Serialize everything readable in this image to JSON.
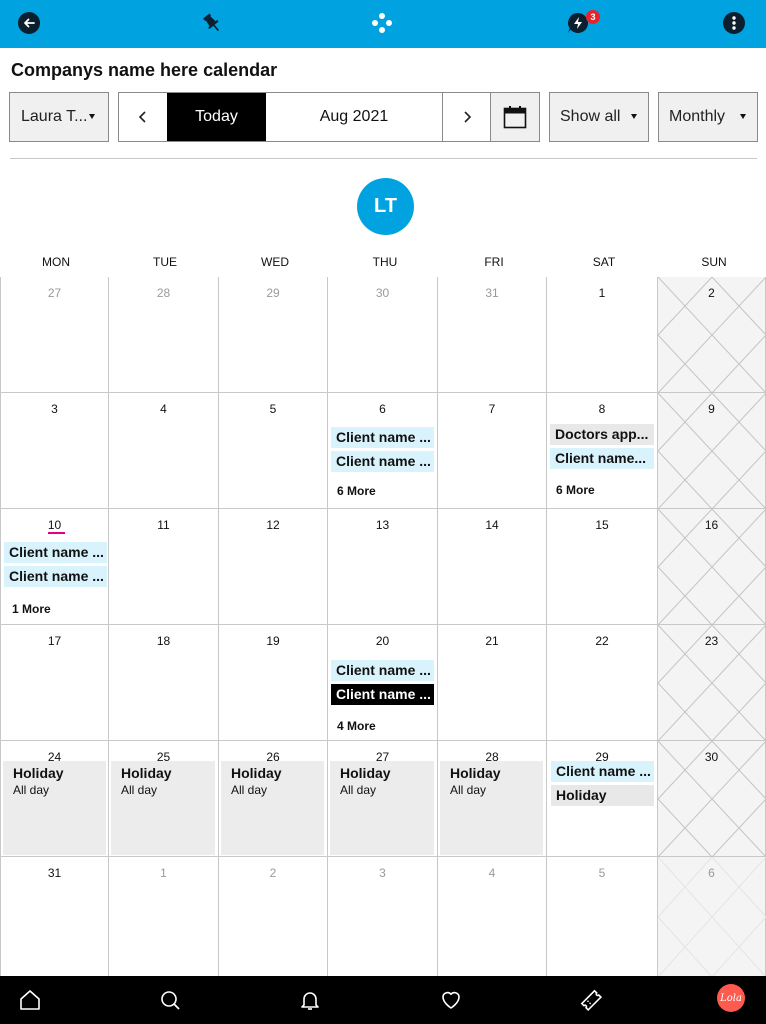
{
  "topbar": {
    "icons": [
      "back-icon",
      "pin-icon",
      "apps-icon",
      "notifications-bolt-icon",
      "more-vertical-icon"
    ],
    "badge_count": "3",
    "accent": "#00a3e0"
  },
  "page_title": "Companys name here calendar",
  "toolbar": {
    "user_select": "Laura T...",
    "today_label": "Today",
    "period_label": "Aug 2021",
    "filter_select": "Show all",
    "view_select": "Monthly"
  },
  "avatar_initials": "LT",
  "weekdays": [
    "MON",
    "TUE",
    "WED",
    "THU",
    "FRI",
    "SAT",
    "SUN"
  ],
  "weeks": [
    [
      "27",
      "28",
      "29",
      "30",
      "31",
      "1",
      "2"
    ],
    [
      "3",
      "4",
      "5",
      "6",
      "7",
      "8",
      "9"
    ],
    [
      "10",
      "11",
      "12",
      "13",
      "14",
      "15",
      "16"
    ],
    [
      "17",
      "18",
      "19",
      "20",
      "21",
      "22",
      "23"
    ],
    [
      "24",
      "25",
      "26",
      "27",
      "28",
      "29",
      "30"
    ],
    [
      "31",
      "1",
      "2",
      "3",
      "4",
      "5",
      "6"
    ]
  ],
  "events": {
    "aug6": {
      "items": [
        "Client name ...",
        "Client name ..."
      ],
      "more": "6 More"
    },
    "aug8": {
      "items": [
        "Doctors app...",
        "Client name..."
      ],
      "more": "6 More"
    },
    "aug10": {
      "items": [
        "Client name ...",
        "Client name ..."
      ],
      "more": "1 More"
    },
    "aug20": {
      "items": [
        "Client name ...",
        "Client name ..."
      ],
      "more": "4 More"
    },
    "holiday": {
      "title": "Holiday",
      "subtitle": "All day"
    },
    "aug29": {
      "items": [
        "Client name ...",
        "Holiday"
      ]
    }
  },
  "bottom_nav": [
    "home-icon",
    "search-icon",
    "bell-icon",
    "heart-icon",
    "ticket-icon"
  ],
  "lola_label": "Lola"
}
